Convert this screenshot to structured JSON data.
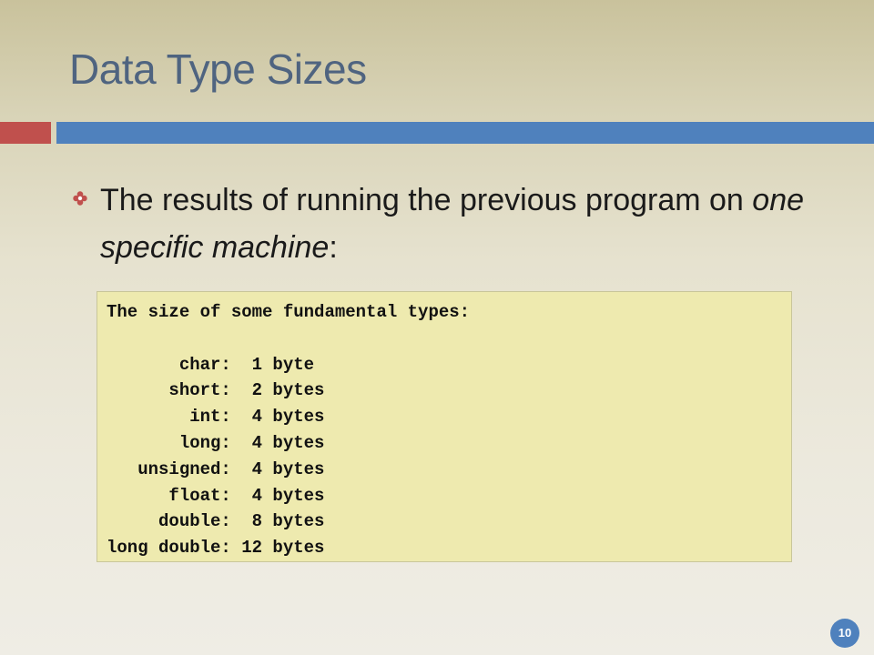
{
  "slide": {
    "title": "Data Type Sizes",
    "bullet": {
      "text_before": "The results of running the previous program on ",
      "text_emphasis": "one specific machine",
      "text_after": ":"
    },
    "output": {
      "lines": [
        "The size of some fundamental types:",
        "",
        "       char:  1 byte",
        "      short:  2 bytes",
        "        int:  4 bytes",
        "       long:  4 bytes",
        "   unsigned:  4 bytes",
        "      float:  4 bytes",
        "     double:  8 bytes",
        "long double: 12 bytes"
      ]
    },
    "page_number": "10"
  },
  "colors": {
    "title": "#4f6480",
    "accent_red": "#c0504d",
    "accent_blue": "#4f81bd",
    "output_background": "#eeeaaf"
  },
  "icons": {
    "bullet": "flower-bullet-icon"
  }
}
